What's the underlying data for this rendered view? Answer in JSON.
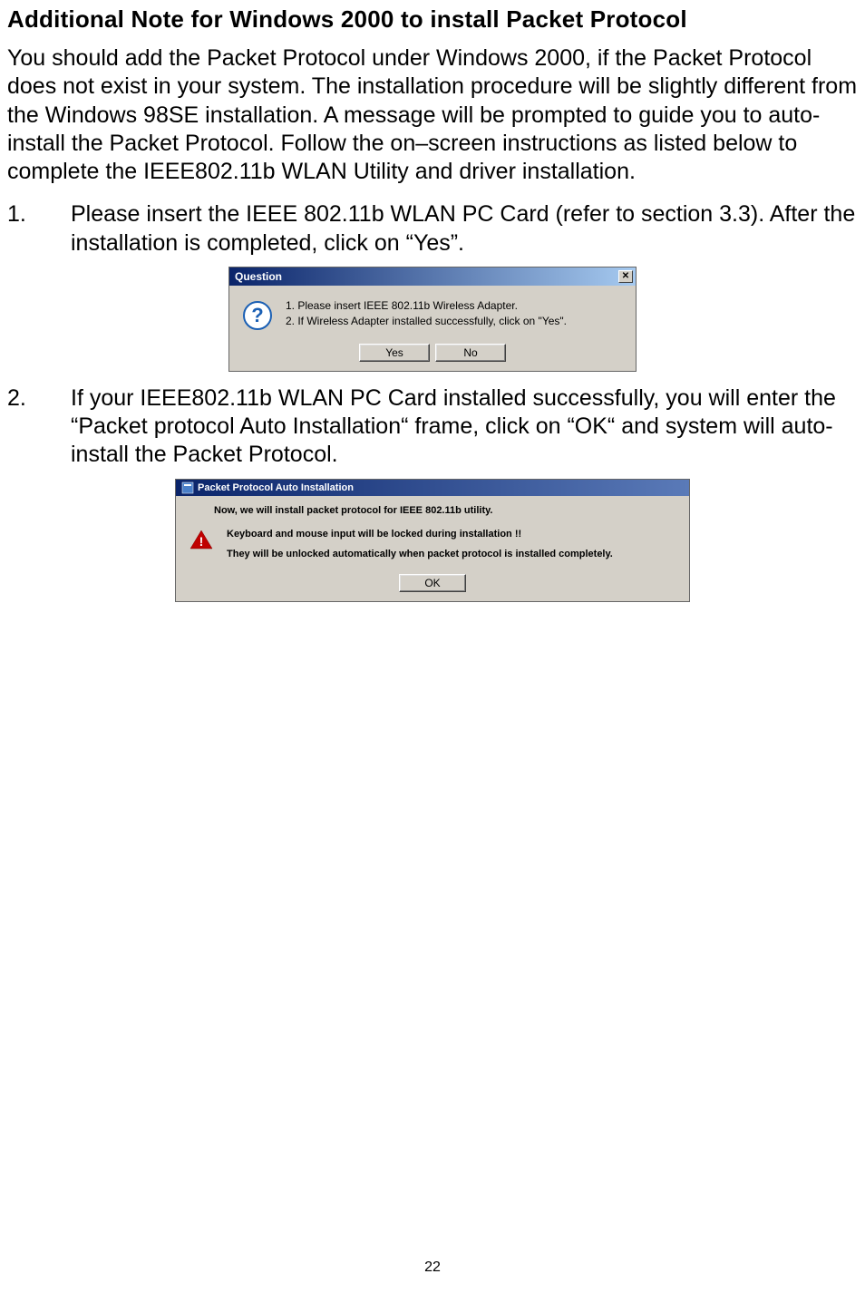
{
  "heading": "Additional Note for Windows 2000 to install Packet Protocol",
  "intro": "You should add the Packet Protocol under Windows 2000, if the Packet Protocol does not exist in your system. The installation procedure will be slightly different from the Windows 98SE installation. A message will be prompted to guide you to auto-install the Packet Protocol. Follow the on–screen instructions as listed below to complete the IEEE802.11b WLAN Utility and driver installation.",
  "steps": [
    {
      "num": "1.",
      "text": "Please insert the IEEE 802.11b WLAN PC Card (refer to section 3.3). After the installation is completed, click on “Yes”."
    },
    {
      "num": "2.",
      "text": "If your IEEE802.11b WLAN PC Card installed successfully, you will enter the “Packet protocol Auto Installation“ frame, click on “OK“ and system will auto-install the Packet Protocol."
    }
  ],
  "dialog1": {
    "title": "Question",
    "close": "✕",
    "line1": "1. Please insert IEEE 802.11b Wireless Adapter.",
    "line2": "2. If Wireless Adapter installed successfully, click on \"Yes\".",
    "yes": "Yes",
    "no": "No"
  },
  "dialog2": {
    "title": "Packet Protocol Auto Installation",
    "line1": "Now, we will install packet protocol for IEEE 802.11b utility.",
    "line2": "Keyboard and mouse input will be locked during installation !!",
    "line3": "They will be unlocked automatically when packet protocol is installed completely.",
    "ok": "OK"
  },
  "pageNumber": "22"
}
